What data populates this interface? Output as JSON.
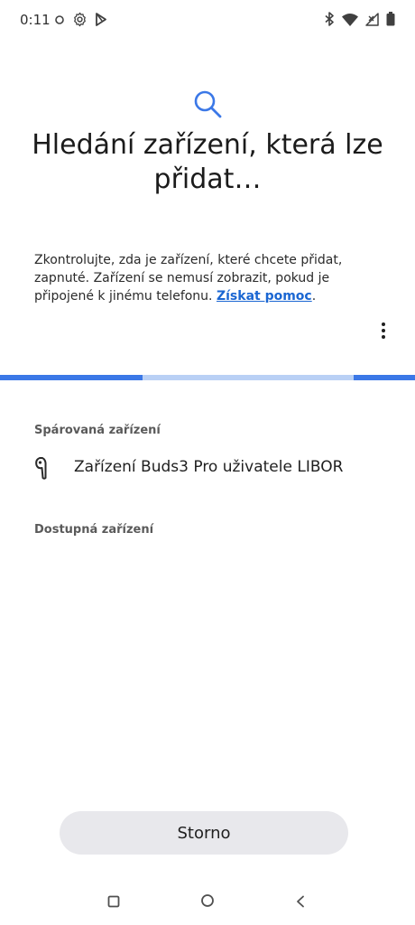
{
  "status_bar": {
    "time": "0:11",
    "left_icons": [
      "circle-icon",
      "gear-icon",
      "play-store-icon"
    ],
    "right_icons": [
      "bluetooth-icon",
      "wifi-icon",
      "signal-icon",
      "battery-icon"
    ]
  },
  "header": {
    "icon": "search-icon",
    "accent_color": "#3b78e7",
    "title": "Hledání zařízení, která lze přidat…"
  },
  "description": {
    "text": "Zkontrolujte, zda je zařízení, které chcete přidat, zapnuté. Zařízení se nemusí zobrazit, pokud je připojené k jinému telefonu. ",
    "link": "Získat pomoc",
    "trailing": "."
  },
  "more_menu": {
    "icon": "more-vert-icon"
  },
  "progress": {
    "type": "indeterminate",
    "color": "#3b78e7",
    "track_color": "#b9d0f5"
  },
  "sections": {
    "paired": {
      "header": "Spárovaná zařízení",
      "devices": [
        {
          "icon": "earbud-icon",
          "name": "Zařízení Buds3 Pro uživatele LIBOR"
        }
      ]
    },
    "available": {
      "header": "Dostupná zařízení",
      "devices": []
    }
  },
  "footer": {
    "cancel_label": "Storno"
  },
  "nav_bar": {
    "buttons": [
      "recents-icon",
      "home-icon",
      "back-icon"
    ]
  }
}
